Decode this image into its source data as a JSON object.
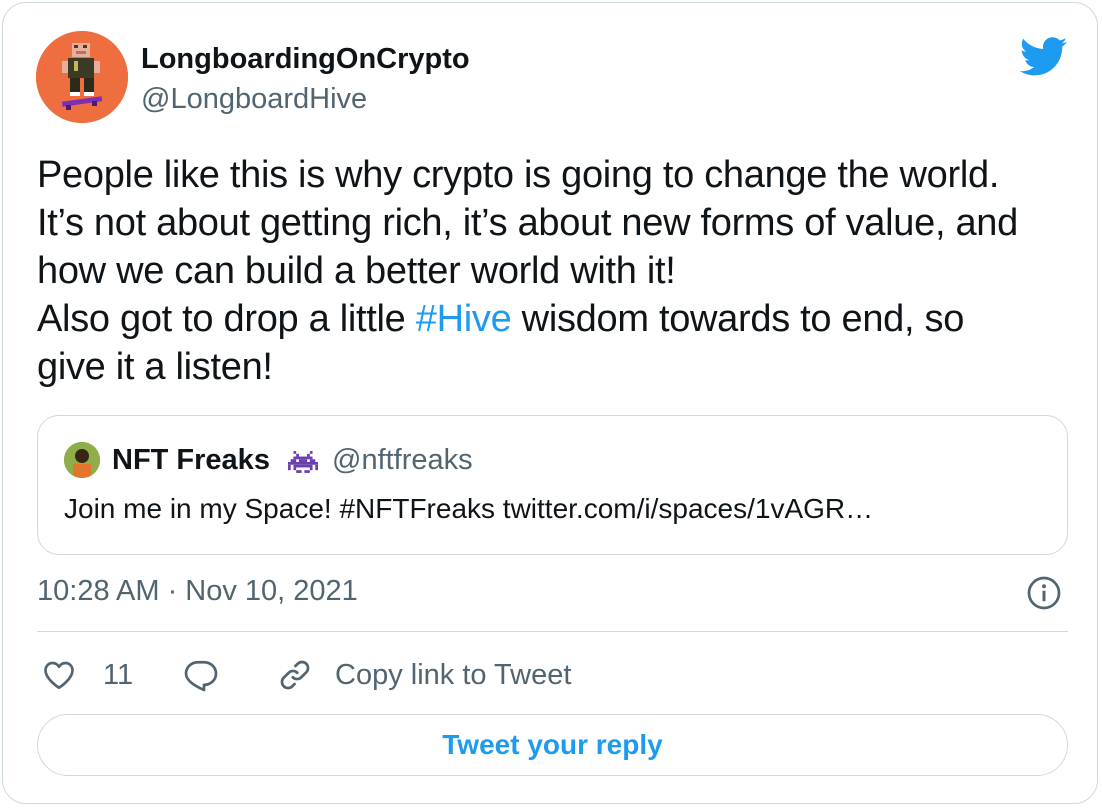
{
  "tweet": {
    "author": {
      "display_name": "LongboardingOnCrypto",
      "handle": "@LongboardHive",
      "avatar_icon": "pixel-skater-avatar"
    },
    "brand_icon": "twitter-bird-icon",
    "text_lines": [
      {
        "parts": [
          "People like this is why crypto is going to change the world."
        ]
      },
      {
        "parts": [
          "It’s not about getting rich, it’s about new forms of value, and"
        ]
      },
      {
        "parts": [
          "how we can build a better world with it!"
        ]
      },
      {
        "before": "Also got to drop a little ",
        "hashtag": "#Hive",
        "after": " wisdom towards to end, so"
      },
      {
        "parts": [
          "give it a listen!"
        ]
      }
    ],
    "quoted": {
      "display_name": "NFT Freaks",
      "badge_icon": "space-invader-icon",
      "handle": "@nftfreaks",
      "text": "Join me in my Space! #NFTFreaks twitter.com/i/spaces/1vAGR…"
    },
    "timestamp": "10:28 AM · Nov 10, 2021",
    "actions": {
      "like_count": "11",
      "copy_link_label": "Copy link to Tweet"
    },
    "reply_button_label": "Tweet your reply"
  },
  "colors": {
    "accent": "#1d9bf0",
    "text": "#0f1419",
    "muted": "#536471",
    "border": "#cfd9de",
    "avatar_bg": "#ee6e3f"
  }
}
